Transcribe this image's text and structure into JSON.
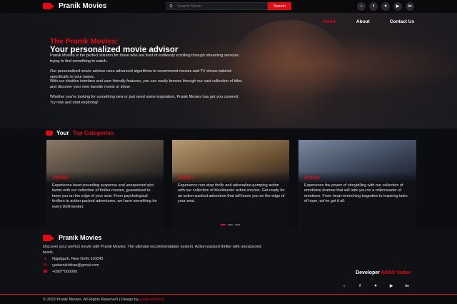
{
  "header": {
    "brand": "Pranik Movies",
    "search_placeholder": "Search Movie...",
    "search_button": "Search",
    "socials": [
      "instagram-icon",
      "facebook-icon",
      "twitter-icon",
      "youtube-icon",
      "linkedin-icon"
    ]
  },
  "nav": {
    "home": "Home",
    "about": "About",
    "contact": "Contact Us"
  },
  "hero": {
    "title_red": "The Pranik Movies:",
    "title_white": "Your personalized movie advisor",
    "p1": "Pranik Movies is the perfect solution for those who are tired of endlessly scrolling through streaming services trying to find something to watch.",
    "p2": "Our personalized movie advisor uses advanced algorithms to recommend movies and TV shows tailored specifically to your tastes.",
    "p3": "With our intuitive interface and user-friendly features, you can easily browse through our vast collection of titles and discover your new favorite movie or show.",
    "p4": "Whether you're looking for something new or just need some inspiration, Pranik Movies has got you covered. Try now and start exploring!"
  },
  "categories": {
    "heading_prefix": "Your",
    "heading_accent": "Top Categories",
    "cards": [
      {
        "title": "Thriller",
        "desc": "Experience heart-pounding suspense and unexpected plot twists with our collection of thriller movies, guaranteed to keep you on the edge of your seat. From psychological thrillers to action-packed adventures, we have something for every thrill-seeker.",
        "tint": "#6b5b4e"
      },
      {
        "title": "Action",
        "desc": "Experience non-stop thrills and adrenaline-pumping action with our collection of blockbuster action movies. Get ready for an action-packed adventure that will leave you on the edge of your seat.",
        "tint": "#8a6a4a"
      },
      {
        "title": "Drama",
        "desc": "Experience the power of storytelling with our collection of emotional dramas that will take you on a rollercoaster of emotions. From heart-wrenching tragedies to inspiring tales of hope, we've got it all.",
        "tint": "#4a5a6e"
      }
    ]
  },
  "footer": {
    "brand": "Pranik Movies",
    "desc": "Discover your perfect movie with Pranik Movies: The ultimate recommendation system. Action-packed thriller with unexpected twists.",
    "location": "Najafgarh, New Delhi 110043",
    "email": "yadavnikhilrao@gmail.com",
    "phone": "+090**000000",
    "dev_label": "Developer",
    "dev_name": "Nikhil Yadav",
    "copyright": "© 2023 Pranik Movies. All Rights Reserved | Design by",
    "designer": "yadavnikhilrao"
  },
  "colors": {
    "accent": "#e50914",
    "background": "#0c0d10"
  }
}
